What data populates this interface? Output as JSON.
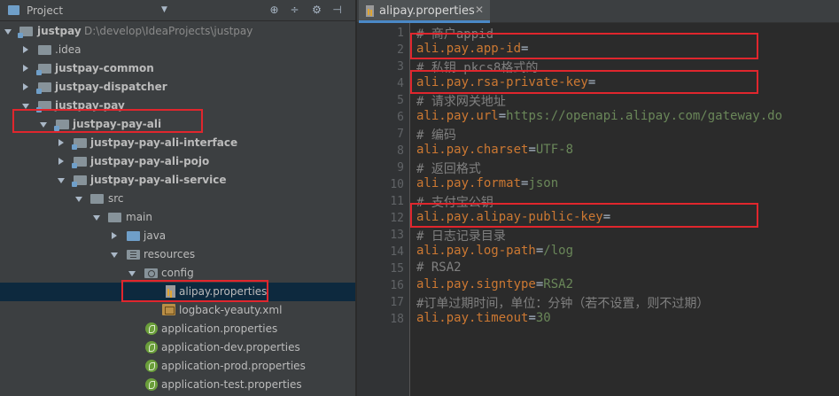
{
  "project_panel": {
    "title": "Project",
    "tree": [
      {
        "label": "justpay",
        "path": "D:\\develop\\IdeaProjects\\justpay",
        "bold": true
      },
      {
        "label": ".idea"
      },
      {
        "label": "justpay-common",
        "bold": true
      },
      {
        "label": "justpay-dispatcher",
        "bold": true
      },
      {
        "label": "justpay-pay",
        "bold": true
      },
      {
        "label": "justpay-pay-ali",
        "bold": true
      },
      {
        "label": "justpay-pay-ali-interface",
        "bold": true
      },
      {
        "label": "justpay-pay-ali-pojo",
        "bold": true
      },
      {
        "label": "justpay-pay-ali-service",
        "bold": true
      },
      {
        "label": "src"
      },
      {
        "label": "main"
      },
      {
        "label": "java"
      },
      {
        "label": "resources"
      },
      {
        "label": "config"
      },
      {
        "label": "alipay.properties"
      },
      {
        "label": "logback-yeauty.xml"
      },
      {
        "label": "application.properties"
      },
      {
        "label": "application-dev.properties"
      },
      {
        "label": "application-prod.properties"
      },
      {
        "label": "application-test.properties"
      }
    ]
  },
  "editor": {
    "tab_label": "alipay.properties",
    "lines": [
      {
        "n": "1",
        "comment": "# 商户appid"
      },
      {
        "n": "2",
        "key": "ali.pay.app-id",
        "eq": "=",
        "value": ""
      },
      {
        "n": "3",
        "comment": "# 私钥 pkcs8格式的"
      },
      {
        "n": "4",
        "key": "ali.pay.rsa-private-key",
        "eq": "=",
        "value": ""
      },
      {
        "n": "5",
        "comment": "# 请求网关地址"
      },
      {
        "n": "6",
        "key": "ali.pay.url",
        "eq": "=",
        "value": "https://openapi.alipay.com/gateway.do"
      },
      {
        "n": "7",
        "comment": "# 编码"
      },
      {
        "n": "8",
        "key": "ali.pay.charset",
        "eq": "=",
        "value": "UTF-8"
      },
      {
        "n": "9",
        "comment": "# 返回格式"
      },
      {
        "n": "10",
        "key": "ali.pay.format",
        "eq": "=",
        "value": "json"
      },
      {
        "n": "11",
        "comment": "# 支付宝公钥"
      },
      {
        "n": "12",
        "key": "ali.pay.alipay-public-key",
        "eq": "=",
        "value": ""
      },
      {
        "n": "13",
        "comment": "# 日志记录目录"
      },
      {
        "n": "14",
        "key": "ali.pay.log-path",
        "eq": "=",
        "value": "/log"
      },
      {
        "n": "15",
        "comment": "# RSA2"
      },
      {
        "n": "16",
        "key": "ali.pay.signtype",
        "eq": "=",
        "value": "RSA2"
      },
      {
        "n": "17",
        "comment": "#订单过期时间，单位：分钟（若不设置，则不过期）"
      },
      {
        "n": "18",
        "key": "ali.pay.timeout",
        "eq": "=",
        "value": "30"
      }
    ]
  },
  "colors": {
    "highlight_box": "#e0262d",
    "key": "#cc7832",
    "value": "#6a8759",
    "comment": "#808080"
  }
}
